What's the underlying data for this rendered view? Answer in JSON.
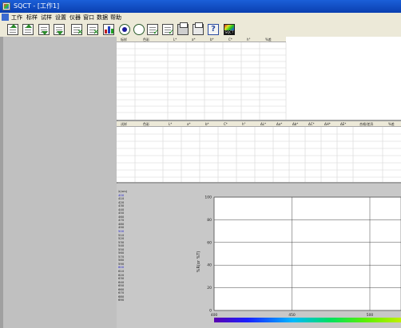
{
  "window": {
    "title": "SQCT  -  [工作1]"
  },
  "menubar": {
    "items": [
      "工作",
      "标样",
      "试样",
      "设置",
      "仪器",
      "窗口",
      "数据",
      "帮助"
    ]
  },
  "toolbar": {
    "icons": [
      "export-up-icon",
      "export-up-icon-2",
      "import-down-icon",
      "import-down-icon-2",
      "delete-doc-icon",
      "delete-doc-icon-2",
      "bar-chart-icon",
      "radio-on-icon",
      "radio-off-icon",
      "edit-doc-icon",
      "edit-doc-icon-2",
      "printer-icon",
      "print-preview-icon",
      "help-icon",
      "sqct-logo-icon"
    ],
    "help_glyph": "?",
    "sqct_label": "SQCT"
  },
  "std_table": {
    "headers": [
      "标样",
      "色彩",
      "L*",
      "a*",
      "b*",
      "C*",
      "h°",
      "%差"
    ]
  },
  "sample_table": {
    "headers": [
      "试样",
      "色彩",
      "L*",
      "a*",
      "b*",
      "C*",
      "h°",
      "ΔL*",
      "Δa*",
      "Δb*",
      "ΔC*",
      "ΔH*",
      "ΔE*",
      "合格/差异",
      "%差"
    ]
  },
  "spectral": {
    "wavelength_label": "λ(nm)",
    "wavelengths": [
      "400",
      "410",
      "420",
      "430",
      "440",
      "450",
      "460",
      "470",
      "480",
      "490",
      "500",
      "510",
      "520",
      "530",
      "540",
      "550",
      "560",
      "570",
      "580",
      "590",
      "600",
      "610",
      "620",
      "630",
      "640",
      "650",
      "660",
      "670",
      "680",
      "690"
    ],
    "highlighted": [
      "400",
      "500",
      "600"
    ]
  },
  "chart_data": {
    "type": "line",
    "ylabel": "%R(or %T)",
    "xlabel": "",
    "title": "",
    "ylim": [
      0,
      100
    ],
    "yticks": [
      0,
      20,
      40,
      60,
      80,
      100
    ],
    "xticks": [
      400,
      450,
      500
    ],
    "x_range": [
      400,
      520
    ],
    "series": [],
    "grid": true,
    "spectrum_bar": true
  }
}
